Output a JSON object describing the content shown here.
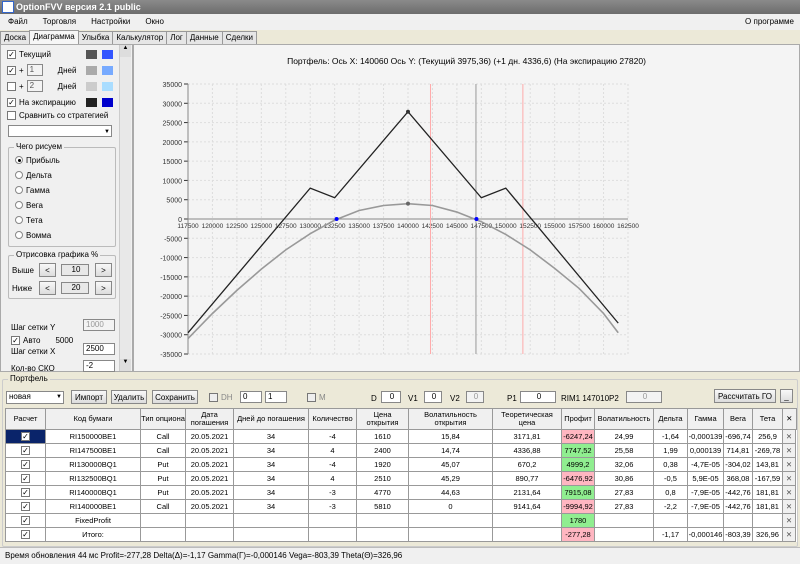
{
  "window": {
    "title": "OptionFVV версия 2.1 public"
  },
  "menu": [
    "Файл",
    "Торговля",
    "Настройки",
    "Окно"
  ],
  "menu_right": "О программе",
  "tabs": [
    "Доска",
    "Диаграмма",
    "Улыбка",
    "Калькулятор",
    "Лог",
    "Данные",
    "Сделки"
  ],
  "active_tab": "Диаграмма",
  "left": {
    "series_rows": [
      {
        "checked": true,
        "label": "Текущий",
        "colors": [
          "#555555",
          "#3355ff"
        ]
      },
      {
        "checked": true,
        "plus": "+",
        "days": "1",
        "unit": "Дней",
        "colors": [
          "#aaaaaa",
          "#77aaff"
        ]
      },
      {
        "checked": false,
        "plus": "+",
        "days": "2",
        "unit": "Дней",
        "colors": [
          "#cccccc",
          "#aaddff"
        ]
      },
      {
        "checked": true,
        "label": "На экспирацию",
        "colors": [
          "#222222",
          "#0000cc"
        ]
      }
    ],
    "compare_label": "Сравнить со стратегией",
    "compare_checked": false,
    "draw_group": {
      "title": "Чего рисуем",
      "options": [
        "Прибыль",
        "Дельта",
        "Гамма",
        "Вега",
        "Тета",
        "Вомма"
      ],
      "selected": "Прибыль"
    },
    "range_group": {
      "title": "Отрисовка графика %",
      "above_label": "Выше",
      "above_value": "10",
      "below_label": "Ниже",
      "below_value": "20",
      "dec": "<",
      "inc": ">"
    },
    "grid_y_label": "Шаг сетки Y",
    "grid_y_value": "1000",
    "auto_label": "Авто",
    "auto_checked": true,
    "auto_value": "5000",
    "grid_x_label": "Шаг сетки X",
    "grid_x_value": "2500",
    "sko_label": "Кол-во СКО",
    "sko_value": "-2"
  },
  "chart_data": {
    "type": "line",
    "title": "Портфель: Ось X: 140060 Ось Y:  (Текущий 3975,36)  (+1 дн. 4336,6)  (На экспирацию 27820)",
    "xlim": [
      117500,
      162500
    ],
    "ylim": [
      -35000,
      35000
    ],
    "xticks": [
      117500,
      120000,
      122500,
      125000,
      127500,
      130000,
      132500,
      135000,
      137500,
      140000,
      142500,
      145000,
      147500,
      150000,
      152500,
      155000,
      157500,
      160000,
      162500
    ],
    "yticks": [
      35000,
      30000,
      25000,
      20000,
      15000,
      10000,
      5000,
      0,
      -5000,
      -10000,
      -15000,
      -20000,
      -25000,
      -30000,
      -35000
    ],
    "grid": true,
    "series": [
      {
        "id": "expiration",
        "color": "#222222",
        "points": [
          [
            117500,
            -29500
          ],
          [
            130000,
            8000
          ],
          [
            132500,
            5500
          ],
          [
            140000,
            27820
          ],
          [
            147500,
            5500
          ],
          [
            150000,
            8000
          ],
          [
            161500,
            -27000
          ]
        ]
      },
      {
        "id": "current",
        "color": "#999999",
        "points": [
          [
            117500,
            -31000
          ],
          [
            120000,
            -24500
          ],
          [
            122500,
            -18500
          ],
          [
            125000,
            -13000
          ],
          [
            127500,
            -8000
          ],
          [
            130000,
            -3800
          ],
          [
            132500,
            -300
          ],
          [
            135000,
            2200
          ],
          [
            137500,
            3500
          ],
          [
            140000,
            3975
          ],
          [
            142500,
            3500
          ],
          [
            145000,
            1800
          ],
          [
            147500,
            -700
          ],
          [
            150000,
            -4000
          ],
          [
            152500,
            -8000
          ],
          [
            155000,
            -12800
          ],
          [
            157500,
            -18000
          ],
          [
            160000,
            -24500
          ],
          [
            161500,
            -29500
          ]
        ]
      }
    ],
    "vlines": [
      {
        "x": 142300,
        "color": "#ffaaaa"
      },
      {
        "x": 151750,
        "color": "#ffaaaa"
      },
      {
        "x": 146950,
        "color": "#999999"
      }
    ],
    "markers": [
      {
        "x": 132700,
        "y": 0,
        "color": "#0000ff"
      },
      {
        "x": 147000,
        "y": 0,
        "color": "#0000ff"
      },
      {
        "x": 140000,
        "y": 27820,
        "color": "#333333"
      },
      {
        "x": 140000,
        "y": 3975,
        "color": "#666666"
      }
    ]
  },
  "portfolio": {
    "title": "Портфель",
    "select": "новая",
    "import": "Импорт",
    "delete": "Удалить",
    "save": "Сохранить",
    "dh_label": "DH",
    "spin1": "0",
    "spin2": "1",
    "m_label": "M",
    "d_label": "D",
    "d_value": "0",
    "v1_label": "V1",
    "v1_value": "0",
    "v2_label": "V2",
    "v2_value": "0",
    "p1_label": "P1",
    "p1_value": "0",
    "rim": "RIM1 147010",
    "p2_label": "P2",
    "p2_value": "0",
    "calc_go": "Рассчитать ГО",
    "min": "_",
    "columns": [
      "Расчет",
      "Код бумаги",
      "Тип опциона",
      "Дата погашения",
      "Дней до погашения",
      "Количество",
      "Цена открытия",
      "Волатильность открытия",
      "Теоретическая цена",
      "Профит",
      "Волатильность",
      "Дельта",
      "Гамма",
      "Вега",
      "Тета",
      "✕"
    ],
    "rows": [
      {
        "code": "RI150000BE1",
        "type": "Call",
        "date": "20.05.2021",
        "days": "34",
        "qty": "-4",
        "price": "1610",
        "vol_open": "15,84",
        "theo": "3171,81",
        "profit": "-6247,24",
        "vol": "24,99",
        "delta": "-1,64",
        "gamma": "-0,000139",
        "vega": "-696,74",
        "theta": "256,9"
      },
      {
        "code": "RI147500BE1",
        "type": "Call",
        "date": "20.05.2021",
        "days": "34",
        "qty": "4",
        "price": "2400",
        "vol_open": "14,74",
        "theo": "4336,88",
        "profit": "7747,52",
        "vol": "25,58",
        "delta": "1,99",
        "gamma": "0,000139",
        "vega": "714,81",
        "theta": "-269,78"
      },
      {
        "code": "RI130000BQ1",
        "type": "Put",
        "date": "20.05.2021",
        "days": "34",
        "qty": "-4",
        "price": "1920",
        "vol_open": "45,07",
        "theo": "670,2",
        "profit": "4999,2",
        "vol": "32,06",
        "delta": "0,38",
        "gamma": "-4,7E-05",
        "vega": "-304,02",
        "theta": "143,81"
      },
      {
        "code": "RI132500BQ1",
        "type": "Put",
        "date": "20.05.2021",
        "days": "34",
        "qty": "4",
        "price": "2510",
        "vol_open": "45,29",
        "theo": "890,77",
        "profit": "-6476,92",
        "vol": "30,86",
        "delta": "-0,5",
        "gamma": "5,9E-05",
        "vega": "368,08",
        "theta": "-167,59"
      },
      {
        "code": "RI140000BQ1",
        "type": "Put",
        "date": "20.05.2021",
        "days": "34",
        "qty": "-3",
        "price": "4770",
        "vol_open": "44,63",
        "theo": "2131,64",
        "profit": "7915,08",
        "vol": "27,83",
        "delta": "0,8",
        "gamma": "-7,9E-05",
        "vega": "-442,76",
        "theta": "181,81"
      },
      {
        "code": "RI140000BE1",
        "type": "Call",
        "date": "20.05.2021",
        "days": "34",
        "qty": "-3",
        "price": "5810",
        "vol_open": "0",
        "theo": "9141,64",
        "profit": "-9994,92",
        "vol": "27,83",
        "delta": "-2,2",
        "gamma": "-7,9E-05",
        "vega": "-442,76",
        "theta": "181,81"
      },
      {
        "code": "FixedProfit",
        "type": "",
        "date": "",
        "days": "",
        "qty": "",
        "price": "",
        "vol_open": "",
        "theo": "",
        "profit": "1780",
        "vol": "",
        "delta": "",
        "gamma": "",
        "vega": "",
        "theta": ""
      },
      {
        "code": "Итого:",
        "type": "",
        "date": "",
        "days": "",
        "qty": "",
        "price": "",
        "vol_open": "",
        "theo": "",
        "profit": "-277,28",
        "vol": "",
        "delta": "-1,17",
        "gamma": "-0,000146",
        "vega": "-803,39",
        "theta": "326,96"
      }
    ]
  },
  "status": "Время обновления 44 мс  Profit=-277,28 Delta(Δ)=-1,17 Gamma(Γ)=-0,000146 Vega=-803,39 Theta(Θ)=326,96"
}
